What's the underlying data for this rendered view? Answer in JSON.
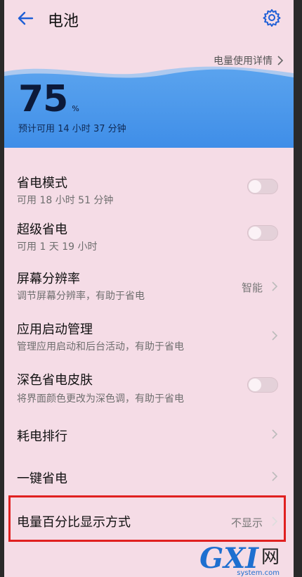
{
  "header": {
    "title": "电池",
    "back_icon": "arrow-left-icon",
    "settings_icon": "gear-icon"
  },
  "battery": {
    "details_link": "电量使用详情",
    "percent": "75",
    "unit": "%",
    "estimate": "预计可用 14 小时 37 分钟",
    "level_fraction": 0.75
  },
  "items": [
    {
      "title": "省电模式",
      "subtitle": "可用 18 小时 51 分钟",
      "control": "toggle",
      "state": "off"
    },
    {
      "title": "超级省电",
      "subtitle": "可用 1 天 19 小时",
      "control": "toggle",
      "state": "off"
    },
    {
      "title": "屏幕分辨率",
      "subtitle": "调节屏幕分辨率，有助于省电",
      "control": "chevron",
      "value": "智能"
    },
    {
      "title": "应用启动管理",
      "subtitle": "管理应用启动和后台活动，有助于省电",
      "control": "chevron"
    },
    {
      "title": "深色省电皮肤",
      "subtitle": "将界面颜色更改为深色调，有助于省电",
      "control": "toggle",
      "state": "off"
    },
    {
      "title": "耗电排行",
      "control": "chevron"
    },
    {
      "title": "一键省电",
      "control": "chevron"
    },
    {
      "title": "电量百分比显示方式",
      "control": "chevron",
      "value": "不显示"
    }
  ],
  "watermark": {
    "main": "GXI",
    "net": "网",
    "site": "system.com"
  },
  "colors": {
    "accent": "#1f5fd6",
    "hero_blue": "#3f8ee8",
    "highlight": "#e02020",
    "background": "#f5dce6"
  }
}
